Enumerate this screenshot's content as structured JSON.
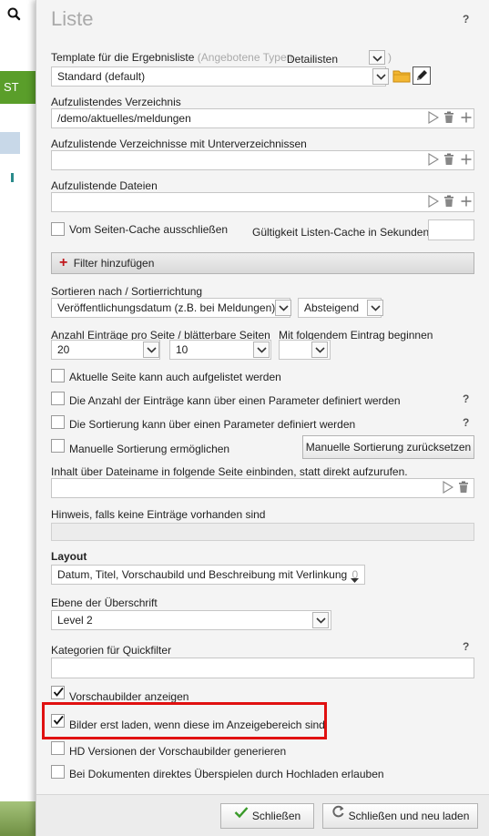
{
  "background": {
    "green_tab_text": "ST"
  },
  "dialog": {
    "title": "Liste",
    "help_symbol": "?",
    "template": {
      "label": "Template für die Ergebnisliste",
      "types_note_open": "(Angebotene Typen",
      "types_value": "Detailisten",
      "types_note_close": ")",
      "value": "Standard (default)"
    },
    "verzeichnis": {
      "label": "Aufzulistendes Verzeichnis",
      "value": "/demo/aktuelles/meldungen"
    },
    "verzeichnisse_unter": {
      "label": "Aufzulistende Verzeichnisse mit Unterverzeichnissen",
      "value": ""
    },
    "dateien": {
      "label": "Aufzulistende Dateien",
      "value": ""
    },
    "cache": {
      "exclude_label": "Vom Seiten-Cache ausschließen",
      "validity_label": "Gültigkeit Listen-Cache in Sekunden",
      "validity_value": ""
    },
    "filter": {
      "plus": "+",
      "label": "Filter hinzufügen"
    },
    "sort": {
      "label": "Sortieren nach / Sortierrichtung",
      "field_value": "Veröffentlichungsdatum (z.B. bei Meldungen)",
      "direction_value": "Absteigend"
    },
    "paging": {
      "label": "Anzahl Einträge pro Seite / blätterbare Seiten",
      "start_label": "Mit folgendem Eintrag beginnen",
      "per_page": "20",
      "pages": "10",
      "start": ""
    },
    "options1": [
      {
        "label": "Aktuelle Seite kann auch aufgelistet werden",
        "checked": false,
        "help": false
      },
      {
        "label": "Die Anzahl der Einträge kann über einen Parameter definiert werden",
        "checked": false,
        "help": true
      },
      {
        "label": "Die Sortierung kann über einen Parameter definiert werden",
        "checked": false,
        "help": true
      },
      {
        "label": "Manuelle Sortierung ermöglichen",
        "checked": false,
        "help": false
      }
    ],
    "reset_sort_button": "Manuelle Sortierung zurücksetzen",
    "include": {
      "label": "Inhalt über Dateiname in folgende Seite einbinden, statt direkt aufzurufen.",
      "value": ""
    },
    "empty_hint": {
      "label": "Hinweis, falls keine Einträge vorhanden sind",
      "value": ""
    },
    "layout": {
      "label": "Layout",
      "value": "Datum, Titel, Vorschaubild und Beschreibung mit Verlinkung",
      "suffix": "0"
    },
    "heading_level": {
      "label": "Ebene der Überschrift",
      "value": "Level 2"
    },
    "quickfilter": {
      "label": "Kategorien für Quickfilter",
      "value": ""
    },
    "options2": [
      {
        "label": "Vorschaubilder anzeigen",
        "checked": true
      },
      {
        "label": "Bilder erst laden, wenn diese im Anzeigebereich sind",
        "checked": true
      },
      {
        "label": "HD Versionen der Vorschaubilder generieren",
        "checked": false
      },
      {
        "label": "Bei Dokumenten direktes Überspielen durch Hochladen erlauben",
        "checked": false
      }
    ],
    "footer": {
      "close": "Schließen",
      "close_reload": "Schließen und neu laden"
    }
  },
  "colors": {
    "accent_green": "#5a9e2a",
    "highlight_red": "#e01010",
    "filter_plus_red": "#c0161b",
    "folder_orange": "#f2b632"
  }
}
